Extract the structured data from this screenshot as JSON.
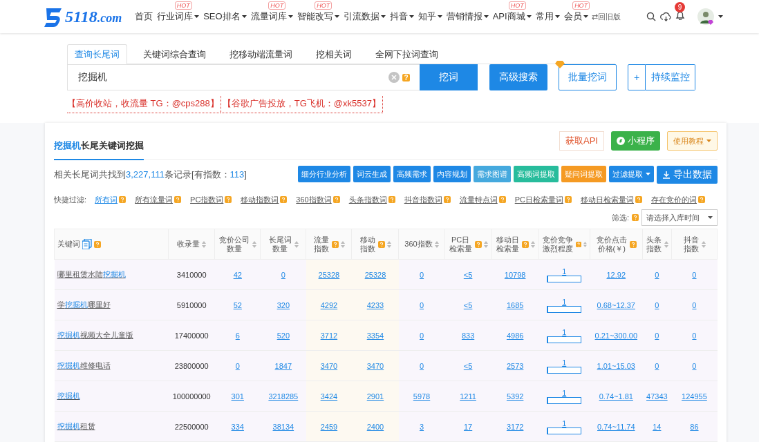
{
  "nav": {
    "logo_text": "5118",
    "logo_suffix": ".com",
    "items": [
      {
        "label": "首页",
        "dropdown": false
      },
      {
        "label": "行业词库",
        "badge": "HOT",
        "dropdown": true
      },
      {
        "label": "SEO排名",
        "dropdown": true
      },
      {
        "label": "流量词库",
        "badge": "HOT",
        "dropdown": true
      },
      {
        "label": "智能改写",
        "badge": "HOT",
        "dropdown": true
      },
      {
        "label": "引流数据",
        "dropdown": true
      },
      {
        "label": "抖音",
        "dropdown": true
      },
      {
        "label": "知乎",
        "dropdown": true
      },
      {
        "label": "营销情报",
        "dropdown": true
      },
      {
        "label": "API商城",
        "badge": "HOT",
        "dropdown": true
      },
      {
        "label": "常用",
        "dropdown": true
      },
      {
        "label": "会员",
        "badge": "HOT",
        "dropdown": true
      }
    ],
    "old_version": "⇄回旧版",
    "notification_count": "9"
  },
  "search": {
    "tabs": [
      {
        "label": "查询长尾词",
        "selected": true
      },
      {
        "label": "关键词综合查询",
        "selected": false
      },
      {
        "label": "挖移动端流量词",
        "selected": false
      },
      {
        "label": "挖相关词",
        "selected": false
      },
      {
        "label": "全网下拉词查询",
        "selected": false
      }
    ],
    "query": "挖掘机",
    "help": "?",
    "search_button": "挖词",
    "advanced_button": "高级搜索",
    "batch_button": "批量挖词",
    "monitor_plus": "+",
    "monitor_button": "持续监控",
    "notices": [
      "【高价收站，收流量 TG：@cps288】",
      "【谷歌广告投放，TG飞机：@xk5537】"
    ]
  },
  "card": {
    "title_keyword": "挖掘机",
    "title": "长尾关键词挖掘",
    "api_button": "获取API",
    "mini_button": "小程序",
    "tutorial_button": "使用教程",
    "summary": [
      {
        "text": "相关长尾词共找到",
        "highlight": false
      },
      {
        "text": "3,227,111",
        "highlight": true
      },
      {
        "text": "条记录[有指数：",
        "highlight": false
      },
      {
        "text": "113",
        "highlight": true
      },
      {
        "text": "]",
        "highlight": false
      }
    ],
    "tools": [
      {
        "label": "细分行业分析",
        "kind": "plain",
        "color": "#1e88e5"
      },
      {
        "label": "词云生成",
        "kind": "plain",
        "color": "#1e88e5"
      },
      {
        "label": "高频需求",
        "kind": "plain",
        "color": "#1e88e5"
      },
      {
        "label": "内容规划",
        "kind": "plain",
        "color": "#1e88e5"
      },
      {
        "label": "需求图谱",
        "kind": "plain",
        "color": "#45a9de"
      },
      {
        "label": "高频词提取",
        "kind": "plain",
        "color": "#27bc9c"
      },
      {
        "label": "疑问词提取",
        "kind": "plain",
        "color": "#f59a23"
      },
      {
        "label": "过滤提取",
        "kind": "dropdown",
        "color": "#1e88e5"
      },
      {
        "label": "导出数据",
        "kind": "export",
        "color": "#1e88e5"
      }
    ],
    "quick_filter_label": "快捷过滤:",
    "quick_filters": [
      {
        "label": "所有词",
        "selected": true
      },
      {
        "label": "所有流量词",
        "selected": false
      },
      {
        "label": "PC指数词",
        "selected": false
      },
      {
        "label": "移动指数词",
        "selected": false
      },
      {
        "label": "360指数词",
        "selected": false
      },
      {
        "label": "头条指数词",
        "selected": false
      },
      {
        "label": "抖音指数词",
        "selected": false
      },
      {
        "label": "流量特点词",
        "selected": false
      },
      {
        "label": "PC日检索量词",
        "selected": false
      },
      {
        "label": "移动日检索量词",
        "selected": false
      },
      {
        "label": "存在竞价的词",
        "selected": false
      }
    ],
    "filter_label": "筛选:",
    "filter_placeholder": "请选择入库时间"
  },
  "table": {
    "columns": [
      {
        "label": "关键词",
        "help": true,
        "sortable": false,
        "highlighted": false
      },
      {
        "label": "收录量",
        "help": false,
        "sortable": true,
        "highlighted": false
      },
      {
        "label": "竞价公司数量",
        "help": false,
        "sortable": true,
        "highlighted": false
      },
      {
        "label": "长尾词数量",
        "help": false,
        "sortable": true,
        "highlighted": false
      },
      {
        "label": "流量指数",
        "help": true,
        "sortable": true,
        "highlighted": true
      },
      {
        "label": "移动指数",
        "help": true,
        "sortable": true,
        "highlighted": true
      },
      {
        "label": "360指数",
        "help": false,
        "sortable": true,
        "highlighted": false
      },
      {
        "label": "PC日检索量",
        "help": true,
        "sortable": true,
        "highlighted": false
      },
      {
        "label": "移动日检索量",
        "help": true,
        "sortable": true,
        "highlighted": false
      },
      {
        "label": "竞价竞争激烈程度",
        "help": true,
        "sortable": true,
        "highlighted": false
      },
      {
        "label": "竞价点击价格(￥)",
        "help": true,
        "sortable": false,
        "highlighted": false
      },
      {
        "label": "头条指数",
        "help": false,
        "sortable": true,
        "highlighted": false
      },
      {
        "label": "抖音指数",
        "help": false,
        "sortable": true,
        "highlighted": false
      }
    ],
    "rows": [
      {
        "keyword": [
          {
            "text": "哪里租赁水陆",
            "highlight": false
          },
          {
            "text": "挖掘机",
            "highlight": true
          }
        ],
        "included": "3410000",
        "values": [
          "42",
          "0",
          "25328",
          "25328",
          "0",
          "<5",
          "10798"
        ],
        "competition": {
          "text": "1",
          "level": 0.02
        },
        "tail": [
          "12.92",
          "0",
          "0"
        ]
      },
      {
        "keyword": [
          {
            "text": "学",
            "highlight": false
          },
          {
            "text": "挖掘机",
            "highlight": true
          },
          {
            "text": "哪里好",
            "highlight": false
          }
        ],
        "included": "5910000",
        "values": [
          "52",
          "320",
          "4292",
          "4233",
          "0",
          "<5",
          "1685"
        ],
        "competition": {
          "text": "1",
          "level": 0.02
        },
        "tail": [
          "0.68~12.37",
          "0",
          "0"
        ]
      },
      {
        "keyword": [
          {
            "text": "挖掘机",
            "highlight": true
          },
          {
            "text": "视频大全儿童版",
            "highlight": false
          }
        ],
        "included": "17400000",
        "values": [
          "6",
          "520",
          "3712",
          "3354",
          "0",
          "833",
          "4986"
        ],
        "competition": {
          "text": "1",
          "level": 0.02
        },
        "tail": [
          "0.21~300.00",
          "0",
          "0"
        ]
      },
      {
        "keyword": [
          {
            "text": "挖掘机",
            "highlight": true
          },
          {
            "text": "维修电话",
            "highlight": false
          }
        ],
        "included": "23800000",
        "values": [
          "0",
          "1847",
          "3470",
          "3470",
          "0",
          "<5",
          "2573"
        ],
        "competition": {
          "text": "1",
          "level": 0.02
        },
        "tail": [
          "1.01~15.03",
          "0",
          "0"
        ]
      },
      {
        "keyword": [
          {
            "text": "挖掘机",
            "highlight": true
          }
        ],
        "included": "100000000",
        "values": [
          "301",
          "3218285",
          "3424",
          "2901",
          "5978",
          "1211",
          "5392"
        ],
        "competition": {
          "text": "1",
          "level": 0.02
        },
        "tail": [
          "0.74~1.81",
          "47343",
          "124955"
        ]
      },
      {
        "keyword": [
          {
            "text": "挖掘机",
            "highlight": true
          },
          {
            "text": "租赁",
            "highlight": false
          }
        ],
        "included": "22500000",
        "values": [
          "334",
          "38134",
          "2459",
          "2400",
          "3",
          "17",
          "3172"
        ],
        "competition": {
          "text": "1",
          "level": 0.02
        },
        "tail": [
          "0.74~11.74",
          "14",
          "86"
        ]
      }
    ]
  }
}
